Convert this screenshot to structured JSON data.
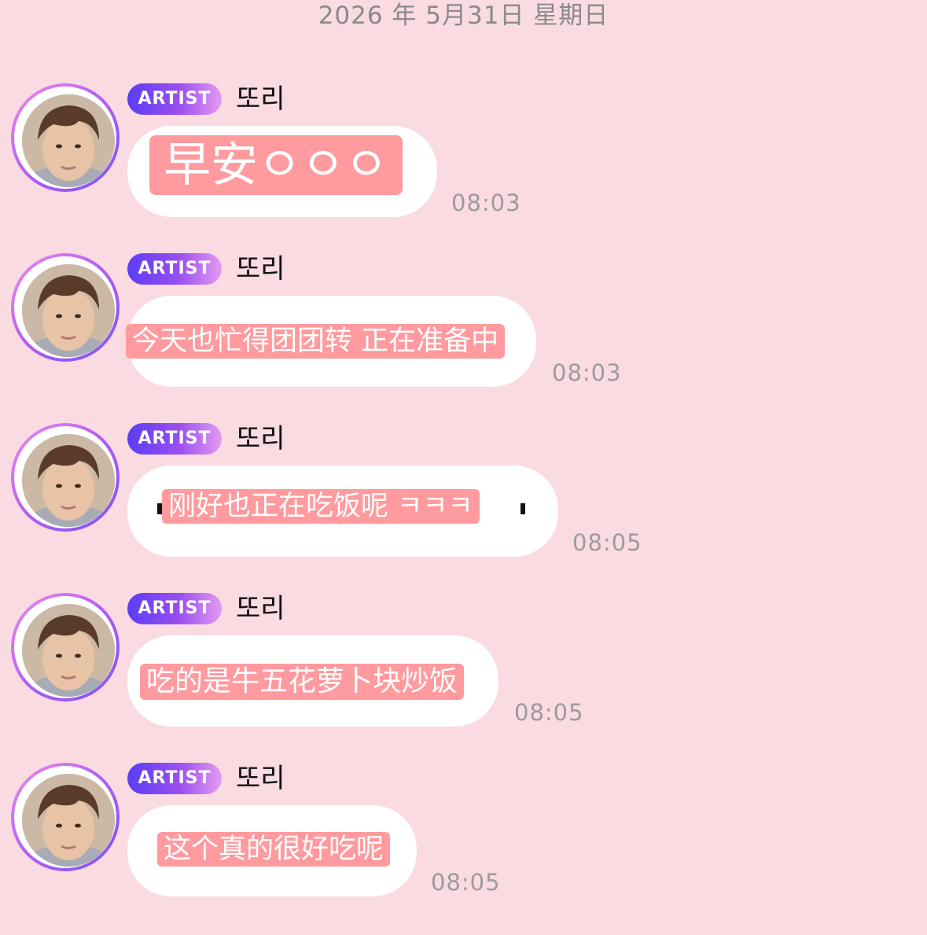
{
  "date_header": "2026 年 5月31日  星期日",
  "messages": [
    {
      "badge": "ARTIST",
      "sender": "또리",
      "text": "早安ㅇㅇㅇ",
      "time": "08:03"
    },
    {
      "badge": "ARTIST",
      "sender": "또리",
      "text": "今天也忙得团团转 正在准备中",
      "time": "08:03"
    },
    {
      "badge": "ARTIST",
      "sender": "또리",
      "text": "刚好也正在吃饭呢 ㅋㅋㅋ",
      "time": "08:05"
    },
    {
      "badge": "ARTIST",
      "sender": "또리",
      "text": "吃的是牛五花萝卜块炒饭",
      "time": "08:05"
    },
    {
      "badge": "ARTIST",
      "sender": "또리",
      "text": "这个真的很好吃呢",
      "time": "08:05"
    }
  ],
  "colors": {
    "background": "#f9dbe1",
    "bubble": "#ffffff",
    "highlight": "#ff9a9e",
    "badge_start": "#5b3df5",
    "badge_end": "#e39af0",
    "time": "#9e9a9b"
  },
  "icons": [
    "artist-avatar"
  ]
}
